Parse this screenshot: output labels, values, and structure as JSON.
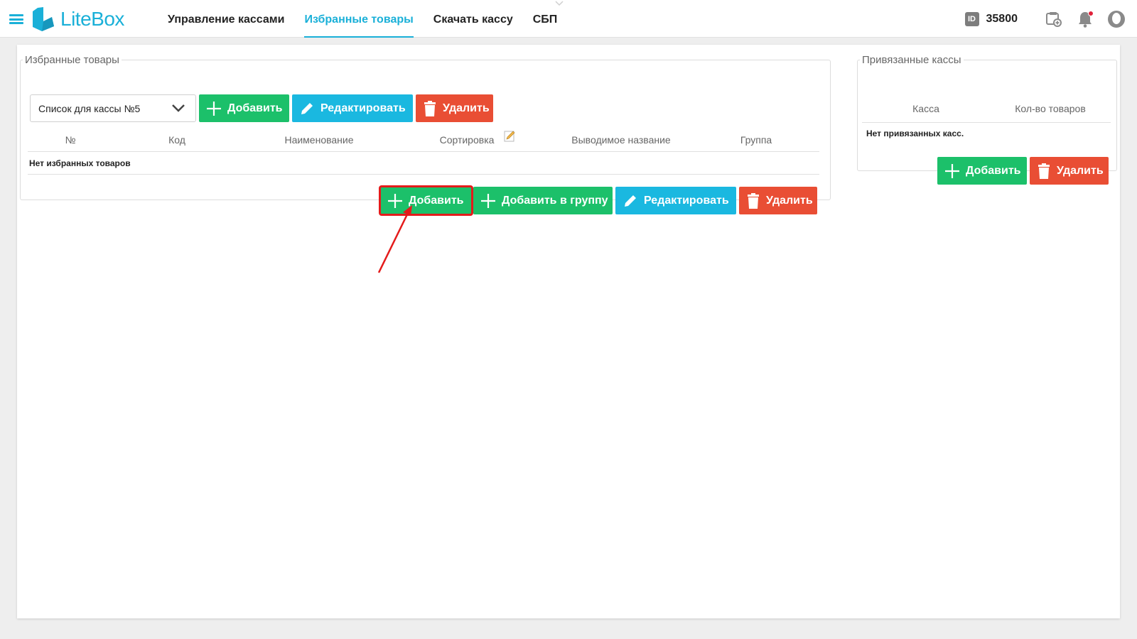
{
  "app": {
    "logo_text": "LiteBox",
    "brand_color": "#1ab0d8"
  },
  "nav": {
    "items": [
      {
        "label": "Управление кассами",
        "active": false
      },
      {
        "label": "Избранные товары",
        "active": true
      },
      {
        "label": "Скачать кассу",
        "active": false
      },
      {
        "label": "СБП",
        "active": false
      }
    ]
  },
  "header_tools": {
    "id_badge": "ID",
    "id_number": "35800",
    "icons": [
      "wallet-add-icon",
      "bell-icon",
      "user-avatar-icon"
    ]
  },
  "favorites": {
    "legend": "Избранные товары",
    "list_select_value": "Список для кассы №5",
    "top_buttons": {
      "add": "Добавить",
      "edit": "Редактировать",
      "delete": "Удалить"
    },
    "columns": [
      "№",
      "Код",
      "Наименование",
      "Сортировка",
      "Выводимое название",
      "Группа"
    ],
    "empty_text": "Нет избранных товаров",
    "bottom_buttons": {
      "add": "Добавить",
      "add_to_group": "Добавить в группу",
      "edit": "Редактировать",
      "delete": "Удалить"
    }
  },
  "linked": {
    "legend": "Привязанные кассы",
    "columns": [
      "Касса",
      "Кол-во товаров"
    ],
    "empty_text": "Нет привязанных касс.",
    "buttons": {
      "add": "Добавить",
      "delete": "Удалить"
    }
  },
  "colors": {
    "green": "#1cc06a",
    "blue": "#1ab8e0",
    "red": "#e94e34",
    "annotation": "#e41b1b"
  }
}
